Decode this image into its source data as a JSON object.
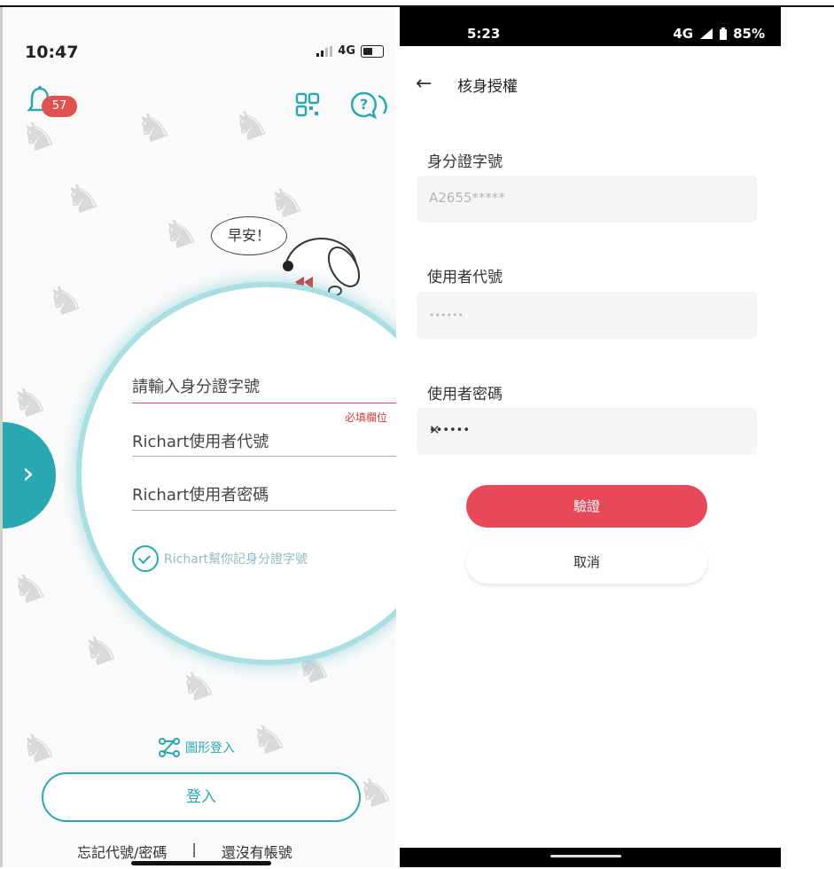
{
  "left_phone": {
    "status": {
      "time": "10:47",
      "network": "4G"
    },
    "notification_badge": "57",
    "greeting": "早安！",
    "fields": {
      "id_placeholder": "請輸入身分證字號",
      "required_hint": "必填欄位",
      "user_code_placeholder": "Richart使用者代號",
      "password_placeholder": "Richart使用者密碼",
      "remember_label": "Richart幫你記身分證字號"
    },
    "pattern_login": "圖形登入",
    "login_button": "登入",
    "forgot_link": "忘記代號/密碼",
    "separator": "|",
    "signup_link": "還沒有帳號"
  },
  "right_phone": {
    "status": {
      "time": "5:23",
      "battery": "85%",
      "network": "4G"
    },
    "header_title": "核身授權",
    "id_label": "身分證字號",
    "id_value": "A2655*****",
    "user_code_label": "使用者代號",
    "user_code_value": "••••••",
    "password_label": "使用者密碼",
    "password_value": "••••••",
    "verify_button": "驗證",
    "cancel_button": "取消"
  },
  "colors": {
    "teal": "#28a9b1",
    "red": "#e8495a",
    "badge": "#e05252"
  }
}
